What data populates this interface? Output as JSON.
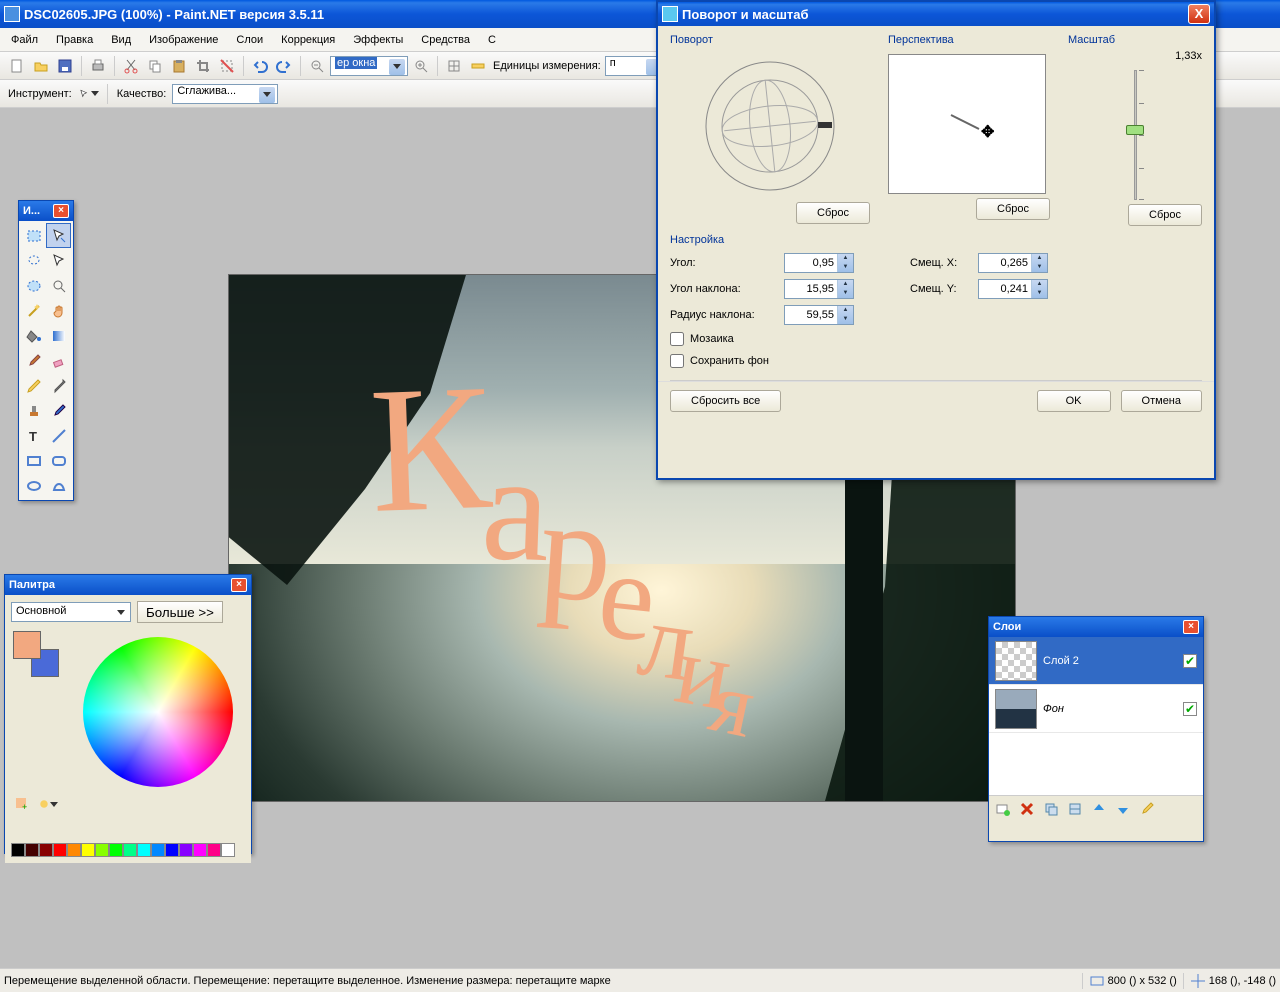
{
  "title": "DSC02605.JPG (100%) - Paint.NET версия 3.5.11",
  "menubar": [
    "Файл",
    "Правка",
    "Вид",
    "Изображение",
    "Слои",
    "Коррекция",
    "Эффекты",
    "Средства",
    "С"
  ],
  "toolbar1": {
    "zoom_value": "ер окна",
    "units_label": "Единицы измерения:",
    "units_value": "п"
  },
  "toolbar2": {
    "tool_label": "Инструмент:",
    "quality_label": "Качество:",
    "quality_value": "Сглажива..."
  },
  "tools_title": "И...",
  "colors": {
    "title": "Палитра",
    "mode": "Основной",
    "more": "Больше >>"
  },
  "layers": {
    "title": "Слои",
    "items": [
      {
        "name": "Слой 2",
        "visible": true,
        "active": true,
        "thumb": "checker"
      },
      {
        "name": "Фон",
        "visible": true,
        "active": false,
        "thumb": "photo"
      }
    ]
  },
  "dialog": {
    "title": "Поворот и масштаб",
    "rotation_label": "Поворот",
    "perspective_label": "Перспектива",
    "scale_label": "Масштаб",
    "scale_value": "1,33x",
    "reset": "Сброс",
    "settings_label": "Настройка",
    "angle_label": "Угол:",
    "angle_value": "0,95",
    "tilt_label": "Угол наклона:",
    "tilt_value": "15,95",
    "radius_label": "Радиус наклона:",
    "radius_value": "59,55",
    "offset_x_label": "Смещ. X:",
    "offset_x_value": "0,265",
    "offset_y_label": "Смещ. Y:",
    "offset_y_value": "0,241",
    "mosaic_label": "Мозаика",
    "keepbg_label": "Сохранить фон",
    "reset_all": "Сбросить все",
    "ok": "OK",
    "cancel": "Отмена"
  },
  "statusbar": {
    "help": "Перемещение выделенной области. Перемещение: перетащите выделенное. Изменение размера: перетащите марке",
    "size": "800 () x 532 ()",
    "pos": "168 (), -148 ()"
  },
  "canvas_text": "Карелия"
}
